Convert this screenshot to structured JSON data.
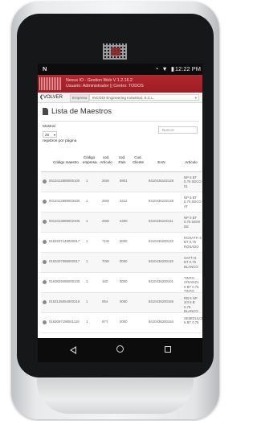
{
  "status_bar": {
    "carrier_icon": "N",
    "icons": "◔ ▼ ▮",
    "time": "12:22 PM"
  },
  "app": {
    "title": "Nexus IO - Gestion Web V 1.2.16.2",
    "user_line": "Usuario: Administrador || Centro: TODOS",
    "header_color": "#a7232a"
  },
  "subbar": {
    "back_label": "VOLVER",
    "company_label": "Empresa",
    "company_value": "INCODI Engineering Industrial, S.C.L."
  },
  "page": {
    "title": "Lista de Maestros"
  },
  "controls": {
    "show_label": "Mostrar",
    "page_size": "25",
    "per_page_label": "registros por página",
    "search_placeholder": "Buscar:"
  },
  "table": {
    "headers": {
      "codigo": "Código maestro",
      "empresa": "Código empresa",
      "articulo": "cod. Artículo",
      "pais": "cod. País",
      "cliente": "Cod. Cliente",
      "ean": "EAN",
      "desc": "Artículo"
    },
    "rows": [
      {
        "codigo": "0013412689000100",
        "empresa": "1",
        "articulo": "26W",
        "pais": "8801",
        "cliente": "",
        "ean": "8410436102128",
        "desc": "NP 6 BT 0.75 SECO 01"
      },
      {
        "codigo": "0013412689003400",
        "empresa": "1",
        "articulo": "26W",
        "pais": "3412",
        "cliente": "",
        "ean": "8410436102128",
        "desc": "NP 6 BT 0.75 SECO AT"
      },
      {
        "codigo": "0013413089002400",
        "empresa": "1",
        "articulo": "28W",
        "pais": "2400",
        "cliente": "",
        "ean": "8410436102111",
        "desc": "NP 6 BT 0.75 SEMI DE"
      },
      {
        "codigo": "0163207149000017",
        "empresa": "1",
        "articulo": "71W",
        "pais": "0000",
        "cliente": "",
        "ean": "8410436200132",
        "desc": "ROSATTI 6 BT 0.75 ROSADO"
      },
      {
        "codigo": "0163407089000017",
        "empresa": "1",
        "articulo": "70W",
        "pais": "0000",
        "cliente": "",
        "ean": "8410436200118",
        "desc": "SATTI 6 BT 0.75 BLANCO"
      },
      {
        "codigo": "0163829489000100",
        "empresa": "1",
        "articulo": "182",
        "pais": "0000",
        "cliente": "",
        "ean": "8410436200101",
        "desc": "TINTO CRIANZA 6 BT 0.75 TINTO"
      },
      {
        "codigo": "0163135054000216",
        "empresa": "1",
        "articulo": "054",
        "pais": "0000",
        "cliente": "",
        "ean": "8410436200156",
        "desc": "RB 6 NP 3/4 6 B 0.75 BLANCO"
      },
      {
        "codigo": "0163097198001116",
        "empresa": "1",
        "articulo": "97Y",
        "pais": "0000",
        "cliente": "",
        "ean": "8410436200154",
        "desc": "SEMIDULCE 6 BT 0.75"
      }
    ]
  },
  "nav": {
    "back_icon": "triangle-back",
    "home_icon": "circle-home",
    "recents_icon": "square-recents"
  }
}
